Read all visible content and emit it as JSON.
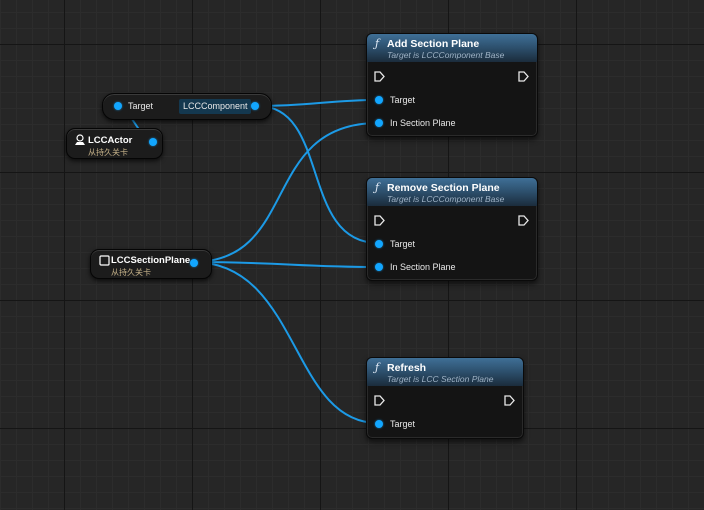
{
  "colors": {
    "pin": "#12a6ff",
    "wire": "#1c9ae6",
    "header_top": "#3f6f96",
    "node_body": "#141414"
  },
  "nodes": {
    "add_section_plane": {
      "title": "Add Section Plane",
      "subtitle": "Target is LCCComponent Base",
      "pins": {
        "target": "Target",
        "in_section_plane": "In Section Plane"
      }
    },
    "remove_section_plane": {
      "title": "Remove Section Plane",
      "subtitle": "Target is LCCComponent Base",
      "pins": {
        "target": "Target",
        "in_section_plane": "In Section Plane"
      }
    },
    "refresh": {
      "title": "Refresh",
      "subtitle": "Target is LCC Section Plane",
      "pins": {
        "target": "Target"
      }
    },
    "get_component": {
      "input_label": "Target",
      "output_label": "LCCComponent"
    },
    "lcc_actor": {
      "title": "LCCActor",
      "subtitle": "从持久关卡"
    },
    "lcc_section_plane": {
      "title": "LCCSectionPlane",
      "subtitle": "从持久关卡"
    }
  },
  "icons": {
    "function": "function-icon",
    "exec_in": "exec-in-pin-icon",
    "exec_out": "exec-out-pin-icon",
    "actor": "actor-icon",
    "object": "object-icon"
  }
}
